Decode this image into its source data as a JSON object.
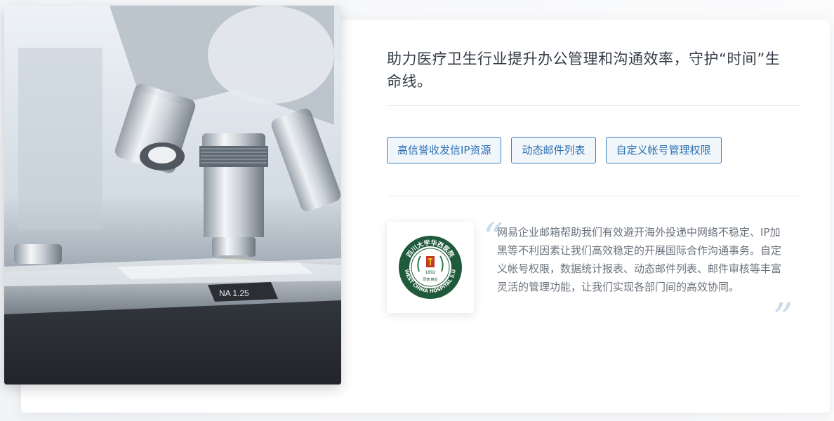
{
  "headline": "助力医疗卫生行业提升办公管理和沟通效率，守护“时间”生命线。",
  "tags": [
    "高信誉收发信IP资源",
    "动态邮件列表",
    "自定义帐号管理权限"
  ],
  "testimonial": {
    "quote": "网易企业邮箱帮助我们有效避开海外投递中网络不稳定、IP加黑等不利因素让我们高效稳定的开展国际合作沟通事务。自定义帐号权限，数据统计报表、动态邮件列表、邮件审核等丰富灵活的管理功能，让我们实现各部门间的高效协同。",
    "logo": {
      "top_text": "四川大学华西医院",
      "bottom_text": "WEST CHINA HOSPITAL S.U",
      "year": "1892",
      "motto": "厚德 精业"
    }
  },
  "photo": {
    "lens_label": "NA 1.25"
  },
  "colors": {
    "accent": "#2a6fb0",
    "tag_border": "#3a7fbf",
    "logo_green": "#1f5a3a",
    "quote_mark": "#c9dbef"
  },
  "icons": {
    "open_quote": "left-double-quote",
    "close_quote": "right-double-quote"
  }
}
